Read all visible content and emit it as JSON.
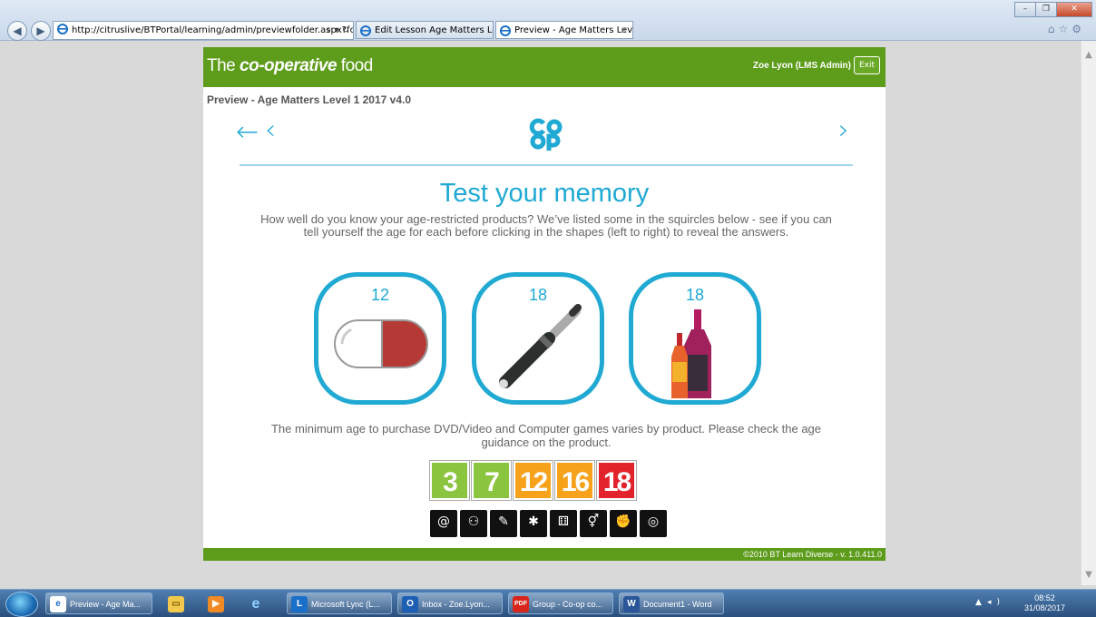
{
  "browser": {
    "url": "http://citruslive/BTPortal/learning/admin/previewfolder.aspx?folder",
    "tabs": [
      {
        "label": "Edit Lesson Age Matters Level ..."
      },
      {
        "label": "Preview - Age Matters Leve..."
      }
    ],
    "window_buttons": {
      "minimize": "–",
      "restore": "❐",
      "close": "✕"
    }
  },
  "app": {
    "brand_prefix": "The",
    "brand_bold": "co-operative",
    "brand_suffix": "food",
    "user": "Zoe Lyon (LMS Admin)",
    "exit_label": "Exit",
    "page_title": "Preview - Age Matters Level 1 2017 v4.0",
    "footer": "©2010 BT Learn Diverse - v. 1.0.411.0",
    "colors": {
      "brand_green": "#5e9c1c",
      "accent_blue": "#1fa9d3"
    }
  },
  "slide": {
    "back_label": "←",
    "prev_label": "‹",
    "next_label": "›",
    "logo_text": "co op",
    "heading": "Test your memory",
    "intro": "How well do you know your age-restricted products? We’ve listed some in the squircles below - see if you can tell yourself the age for each before clicking in the shapes (left to right) to reveal the answers.",
    "squircles": [
      {
        "age": "12",
        "icon": "medicine-capsule-icon"
      },
      {
        "age": "18",
        "icon": "e-cigarette-icon"
      },
      {
        "age": "18",
        "icon": "alcohol-bottles-icon"
      }
    ],
    "min_age_text": "The minimum age to purchase DVD/Video and Computer games varies by product. Please check the age guidance on the product.",
    "pegi_ratings": [
      {
        "label": "3",
        "color": "#8bc43f"
      },
      {
        "label": "7",
        "color": "#8bc43f"
      },
      {
        "label": "12",
        "color": "#f7a21b"
      },
      {
        "label": "16",
        "color": "#f7a21b"
      },
      {
        "label": "18",
        "color": "#e3232b"
      }
    ],
    "descriptor_icons": [
      "bad-language-icon",
      "discrimination-icon",
      "drugs-icon",
      "fear-icon",
      "gambling-icon",
      "sex-icon",
      "violence-icon",
      "online-icon"
    ]
  },
  "taskbar": {
    "items": [
      {
        "label": "Preview - Age Ma...",
        "icon": "ie-icon"
      },
      {
        "label": "",
        "icon": "explorer-icon"
      },
      {
        "label": "",
        "icon": "media-player-icon"
      },
      {
        "label": "",
        "icon": "ie-icon"
      },
      {
        "label": "Microsoft Lync (L...",
        "icon": "lync-icon"
      },
      {
        "label": "Inbox - Zoe.Lyon...",
        "icon": "outlook-icon"
      },
      {
        "label": "Group - Co-op co...",
        "icon": "pdf-icon"
      },
      {
        "label": "Document1 - Word",
        "icon": "word-icon"
      }
    ],
    "clock_time": "08:52",
    "clock_date": "31/08/2017"
  }
}
